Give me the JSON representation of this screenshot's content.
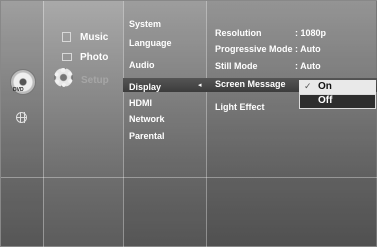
{
  "side_nav": {
    "music_label": "Music",
    "photo_label": "Photo",
    "setup_label": "Setup",
    "disc_label": "DVD"
  },
  "setup_menu": {
    "items": [
      "System",
      "Language",
      "Audio",
      "Display",
      "HDMI",
      "Network",
      "Parental"
    ],
    "selected": "Display"
  },
  "display_settings": {
    "rows": [
      {
        "label": "Resolution",
        "value": ": 1080p"
      },
      {
        "label": "Progressive Mode",
        "value": ": Auto"
      },
      {
        "label": "Still Mode",
        "value": ": Auto"
      },
      {
        "label": "Screen Message",
        "value": ""
      },
      {
        "label": "Light Effect",
        "value": ""
      }
    ]
  },
  "popup": {
    "options": [
      "On",
      "Off"
    ],
    "checked": "On",
    "highlighted": "Off"
  },
  "colors": {
    "background_top": "#a9a9a9",
    "background_bottom": "#5c5c5c",
    "selection_bar": "#444444",
    "popup_light": "#e9e9e9",
    "popup_dark": "#2e2e2e"
  },
  "icons": [
    "dvd-disc-icon",
    "globe-icon",
    "music-icon",
    "photo-icon",
    "gear-icon",
    "check-icon"
  ]
}
